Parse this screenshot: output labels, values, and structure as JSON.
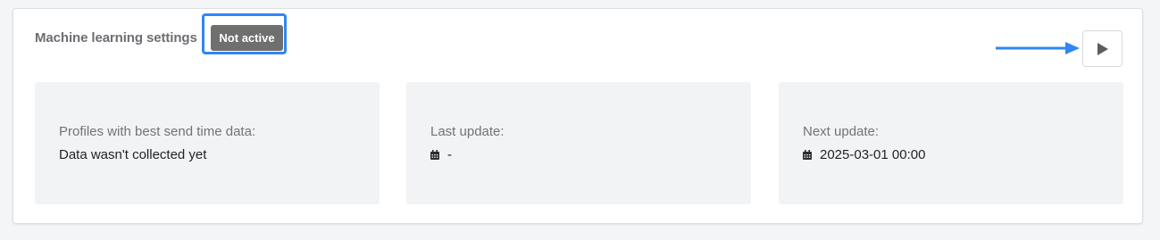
{
  "section": {
    "title": "Machine learning settings",
    "status_badge": "Not active",
    "play_icon": "play-icon",
    "accent_color": "#2f86f6"
  },
  "panels": [
    {
      "label": "Profiles with best send time data:",
      "value": "Data wasn't collected yet"
    },
    {
      "label": "Last update:",
      "value": "-",
      "icon": "calendar-icon"
    },
    {
      "label": "Next update:",
      "value": "2025-03-01 00:00",
      "icon": "calendar-icon"
    }
  ]
}
